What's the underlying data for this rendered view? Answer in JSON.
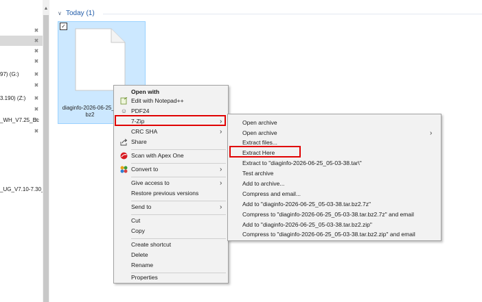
{
  "nav": {
    "items": [
      {
        "label": ""
      },
      {
        "label": ""
      },
      {
        "label": ""
      },
      {
        "label": ""
      },
      {
        "label": "97) (G:)"
      },
      {
        "label": ""
      },
      {
        "label": "3.190) (Z:)"
      },
      {
        "label": ""
      },
      {
        "label": "_WH_V7.25_Ec"
      },
      {
        "label": ""
      },
      {
        "label": "_UG_V7.10-7.30_E"
      }
    ]
  },
  "group": {
    "title": "Today (1)"
  },
  "file": {
    "name": "diaginfo-2026-06-25_05-03-38.tar.bz2",
    "name_line1": "diaginfo-2026-06-25_0",
    "name_line2": "bz2"
  },
  "context_menu": {
    "open_with": "Open with",
    "edit_notepad": "Edit with Notepad++",
    "pdf24": "PDF24",
    "seven_zip": "7-Zip",
    "crc_sha": "CRC SHA",
    "share": "Share",
    "scan_apex": "Scan with Apex One",
    "convert_to": "Convert to",
    "give_access": "Give access to",
    "restore_versions": "Restore previous versions",
    "send_to": "Send to",
    "cut": "Cut",
    "copy": "Copy",
    "create_shortcut": "Create shortcut",
    "delete": "Delete",
    "rename": "Rename",
    "properties": "Properties"
  },
  "submenu": {
    "open_archive": "Open archive",
    "open_archive_more": "Open archive",
    "extract_files": "Extract files...",
    "extract_here": "Extract Here",
    "extract_to": "Extract to \"diaginfo-2026-06-25_05-03-38.tar\\\"",
    "test_archive": "Test archive",
    "add_to_archive": "Add to archive...",
    "compress_email": "Compress and email...",
    "add_to_7z": "Add to \"diaginfo-2026-06-25_05-03-38.tar.bz2.7z\"",
    "compress_7z_email": "Compress to \"diaginfo-2026-06-25_05-03-38.tar.bz2.7z\" and email",
    "add_to_zip": "Add to \"diaginfo-2026-06-25_05-03-38.tar.bz2.zip\"",
    "compress_zip_email": "Compress to \"diaginfo-2026-06-25_05-03-38.tar.bz2.zip\" and email"
  },
  "colors": {
    "highlight_border": "#e00000",
    "selection": "#cce8ff",
    "group_header": "#1e5aa8"
  }
}
